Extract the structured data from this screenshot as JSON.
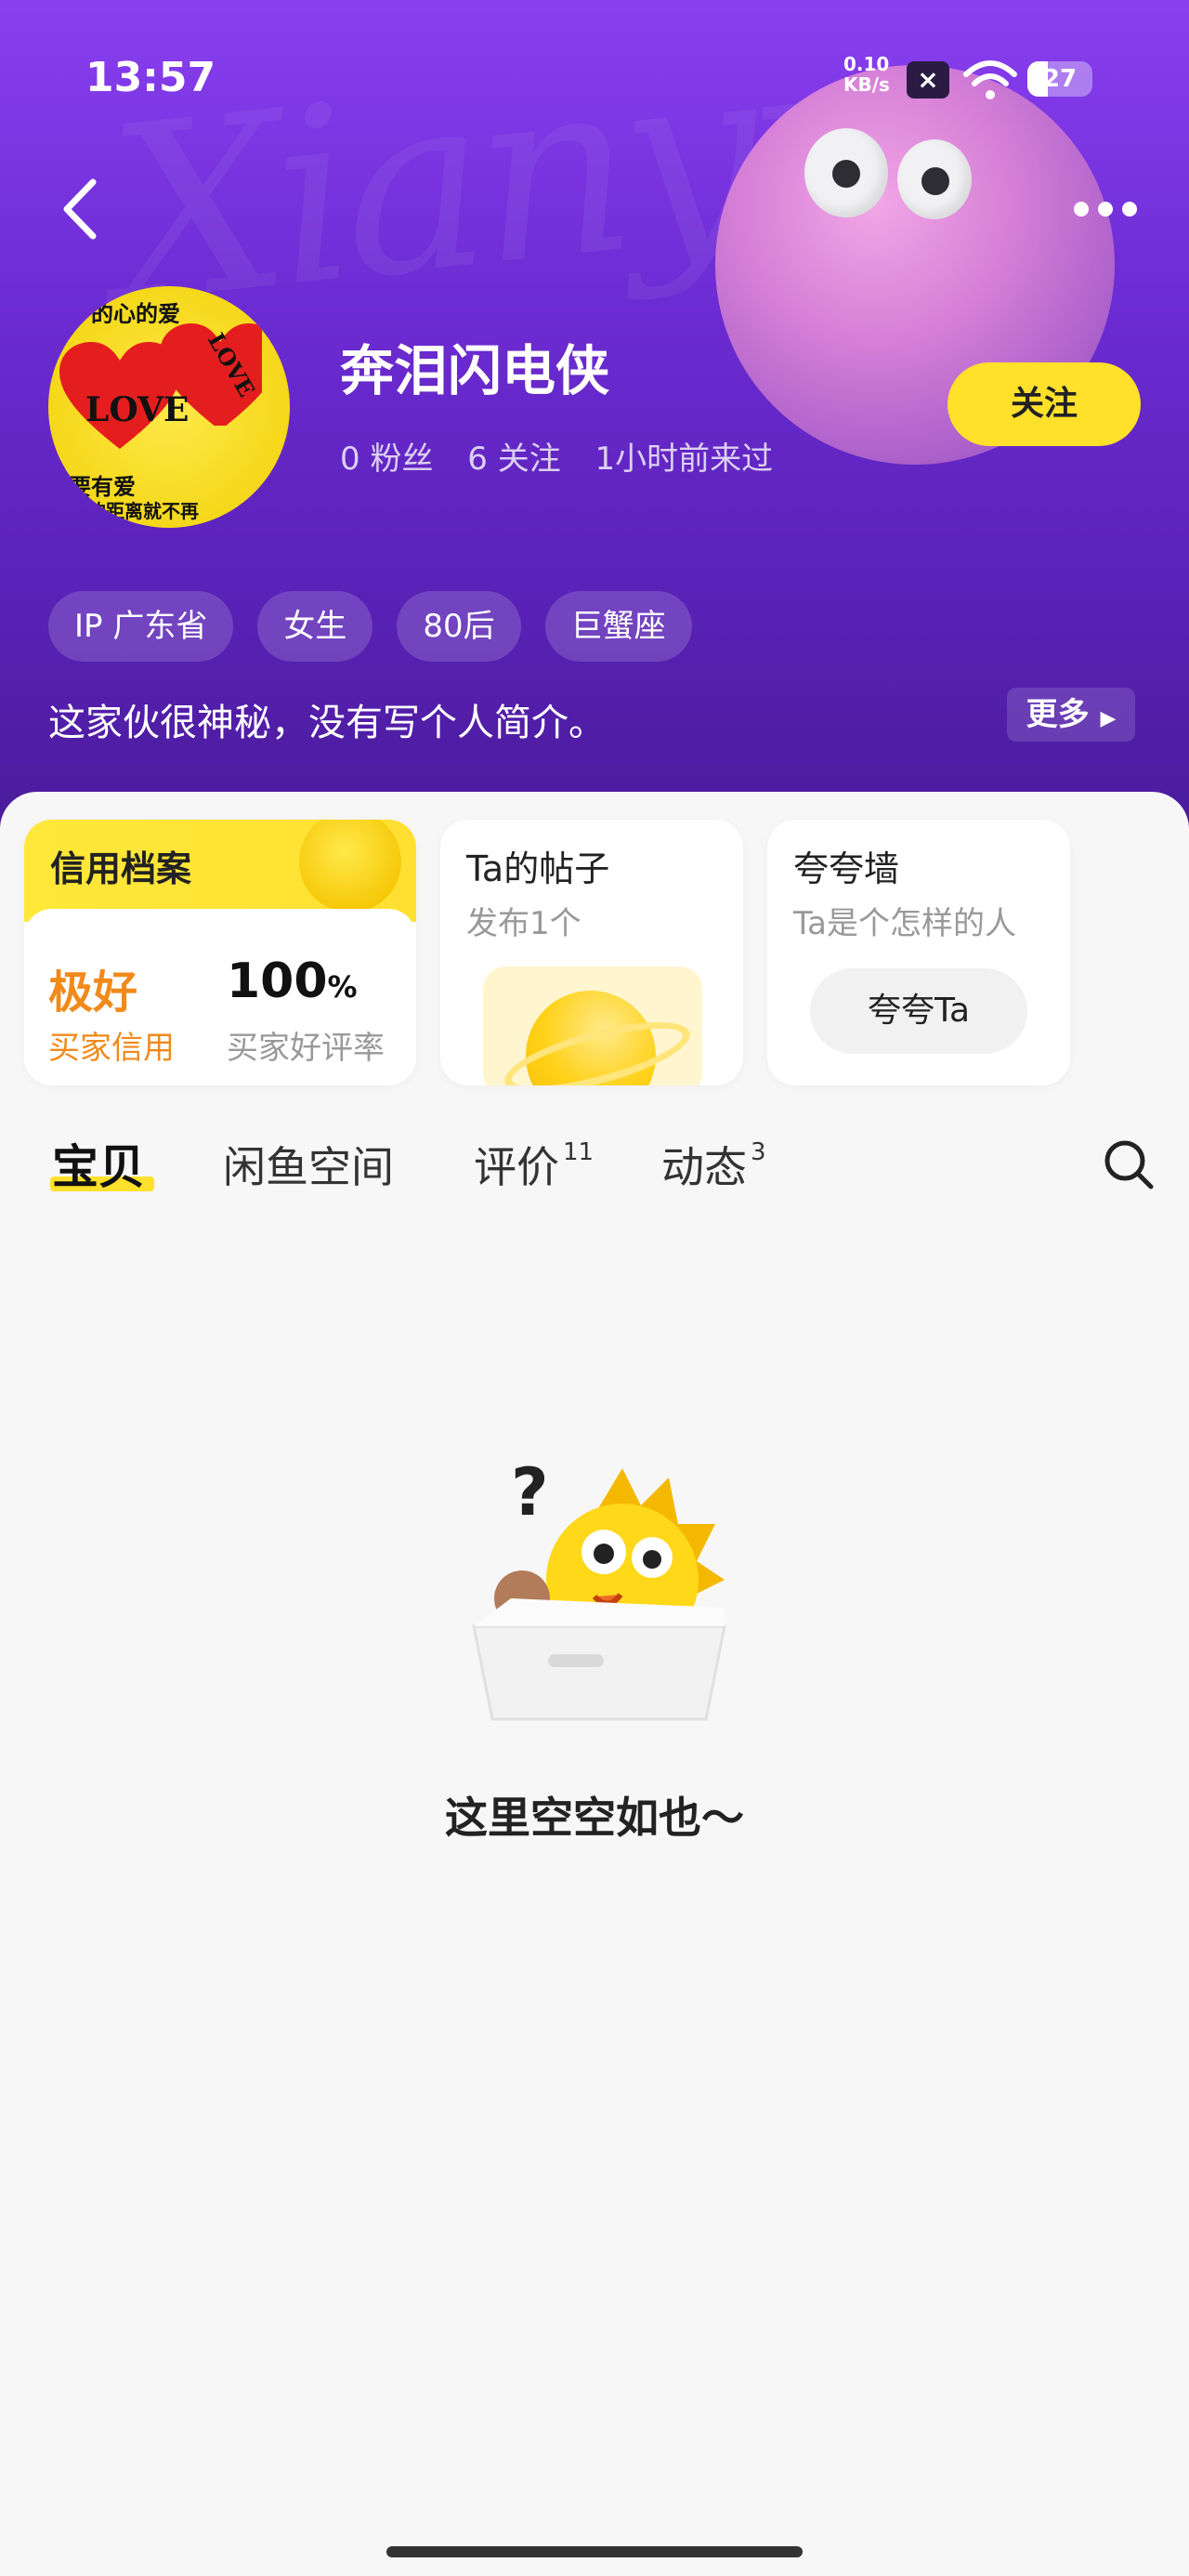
{
  "status_bar": {
    "time": "13:57",
    "net_speed_value": "0.10",
    "net_speed_unit": "KB/s",
    "battery": "27"
  },
  "profile": {
    "nickname": "奔泪闪电侠",
    "fans": "0 粉丝",
    "following": "6 关注",
    "last_seen": "1小时前来过",
    "follow_label": "关注",
    "tags": [
      "IP 广东省",
      "女生",
      "80后",
      "巨蟹座"
    ],
    "bio": "这家伙很神秘，没有写个人简介。",
    "more_label": "更多",
    "avatar_text": {
      "top": "的心的爱",
      "center": "LOVE",
      "side": "LOVE",
      "line1": "要有爱",
      "line2": "心的距离就不再"
    }
  },
  "cards": {
    "credit": {
      "title": "信用档案",
      "rating": "极好",
      "rating_label": "买家信用",
      "rate_value": "100",
      "rate_unit": "%",
      "rate_label": "买家好评率"
    },
    "posts": {
      "title": "Ta的帖子",
      "subtitle": "发布1个"
    },
    "praise": {
      "title": "夸夸墙",
      "subtitle": "Ta是个怎样的人",
      "button": "夸夸Ta"
    }
  },
  "tabs": [
    {
      "label": "宝贝",
      "count": ""
    },
    {
      "label": "闲鱼空间",
      "count": ""
    },
    {
      "label": "评价",
      "count": "11"
    },
    {
      "label": "动态",
      "count": "3"
    }
  ],
  "empty_state": {
    "text": "这里空空如也～"
  },
  "colors": {
    "brand_yellow": "#ffe02b",
    "header_purple": "#6d2cd4",
    "credit_orange": "#f08a1a"
  }
}
